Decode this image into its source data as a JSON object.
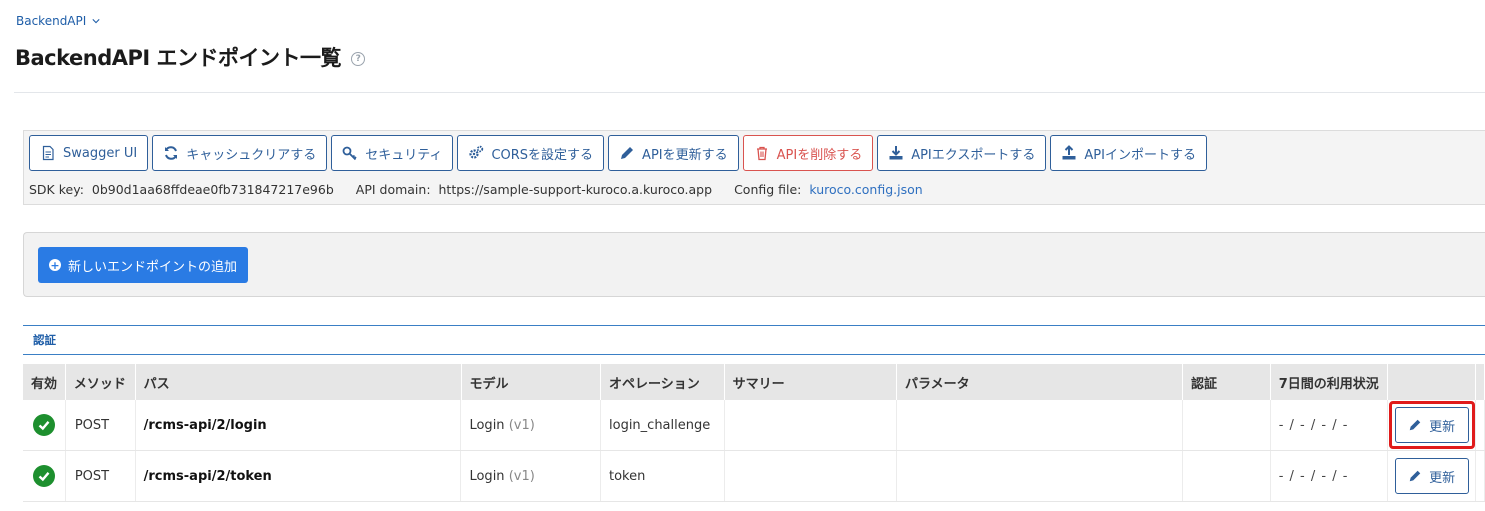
{
  "breadcrumb": {
    "label": "BackendAPI"
  },
  "page": {
    "title": "BackendAPI エンドポイント一覧",
    "help_glyph": "?"
  },
  "toolbar": {
    "buttons": [
      {
        "label": "Swagger UI",
        "icon": "document-icon"
      },
      {
        "label": "キャッシュクリアする",
        "icon": "refresh-icon"
      },
      {
        "label": "セキュリティ",
        "icon": "key-icon"
      },
      {
        "label": "CORSを設定する",
        "icon": "gears-icon"
      },
      {
        "label": "APIを更新する",
        "icon": "pencil-icon"
      },
      {
        "label": "APIを削除する",
        "icon": "trash-icon"
      },
      {
        "label": "APIエクスポートする",
        "icon": "download-icon"
      },
      {
        "label": "APIインポートする",
        "icon": "upload-icon"
      }
    ],
    "sdk_key_label": "SDK key:",
    "sdk_key_value": "0b90d1aa68ffdeae0fb731847217e96b",
    "api_domain_label": "API domain:",
    "api_domain_value": "https://sample-support-kuroco.a.kuroco.app",
    "config_file_label": "Config file:",
    "config_file_value": "kuroco.config.json"
  },
  "add_endpoint": {
    "label": "新しいエンドポイントの追加"
  },
  "section": {
    "title": "認証"
  },
  "table": {
    "headers": [
      "有効",
      "メソッド",
      "パス",
      "モデル",
      "オペレーション",
      "サマリー",
      "パラメータ",
      "認証",
      "7日間の利用状況",
      ""
    ],
    "rows": [
      {
        "method": "POST",
        "path": "/rcms-api/2/login",
        "model": "Login",
        "model_version": "(v1)",
        "operation": "login_challenge",
        "summary": "",
        "parameters": "",
        "auth": "",
        "usage": "- / - / - / -",
        "action": "更新",
        "highlighted": true
      },
      {
        "method": "POST",
        "path": "/rcms-api/2/token",
        "model": "Login",
        "model_version": "(v1)",
        "operation": "token",
        "summary": "",
        "parameters": "",
        "auth": "",
        "usage": "- / - / - / -",
        "action": "更新",
        "highlighted": false
      }
    ]
  },
  "colors": {
    "accent": "#2a7be4",
    "primary_outline": "#2f5f9a",
    "danger": "#d9534f",
    "success": "#1d8f2e",
    "highlight": "#e01b1b"
  }
}
